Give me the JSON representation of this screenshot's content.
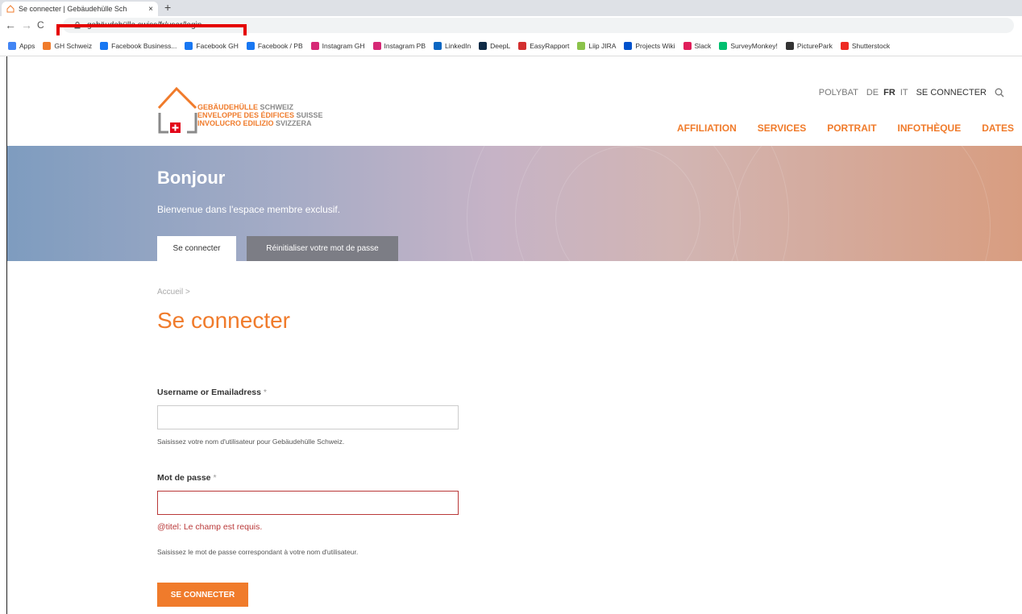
{
  "browser": {
    "tab_title": "Se connecter | Gebäudehülle Sch",
    "tab_close": "×",
    "new_tab": "+",
    "back": "←",
    "forward": "→",
    "reload": "C",
    "url": "gebäudehülle.swiss/fr/user/login",
    "bookmarks": [
      {
        "label": "Apps",
        "icon": "apps-grid-icon",
        "color": "#4285f4"
      },
      {
        "label": "GH Schweiz",
        "icon": "house-icon",
        "color": "#f07b2b"
      },
      {
        "label": "Facebook Business...",
        "icon": "meta-icon",
        "color": "#1877f2"
      },
      {
        "label": "Facebook GH",
        "icon": "facebook-icon",
        "color": "#1877f2"
      },
      {
        "label": "Facebook / PB",
        "icon": "facebook-icon",
        "color": "#1877f2"
      },
      {
        "label": "Instagram GH",
        "icon": "instagram-icon",
        "color": "#d62976"
      },
      {
        "label": "Instagram PB",
        "icon": "instagram-icon",
        "color": "#d62976"
      },
      {
        "label": "LinkedIn",
        "icon": "linkedin-icon",
        "color": "#0a66c2"
      },
      {
        "label": "DeepL",
        "icon": "deepl-icon",
        "color": "#0f2b46"
      },
      {
        "label": "EasyRapport",
        "icon": "easyrapport-icon",
        "color": "#d32f2f"
      },
      {
        "label": "Liip JIRA",
        "icon": "jira-icon",
        "color": "#8bc34a"
      },
      {
        "label": "Projects Wiki",
        "icon": "confluence-icon",
        "color": "#0052cc"
      },
      {
        "label": "Slack",
        "icon": "slack-icon",
        "color": "#e01e5a"
      },
      {
        "label": "SurveyMonkey!",
        "icon": "surveymonkey-icon",
        "color": "#00bf6f"
      },
      {
        "label": "PicturePark",
        "icon": "picturepark-icon",
        "color": "#333333"
      },
      {
        "label": "Shutterstock",
        "icon": "shutterstock-icon",
        "color": "#ee2b24"
      }
    ]
  },
  "site": {
    "logo_lines": [
      {
        "orange": "GEBÄUDEHÜLLE",
        "grey": "SCHWEIZ"
      },
      {
        "orange": "ENVELOPPE DES ÉDIFICES",
        "grey": "SUISSE"
      },
      {
        "orange": "INVOLUCRO EDILIZIO",
        "grey": "SVIZZERA"
      }
    ],
    "util_nav": {
      "polybat": "POLYBAT",
      "langs": [
        "DE",
        "FR",
        "IT"
      ],
      "current_lang": "FR",
      "login": "SE CONNECTER"
    },
    "main_nav": [
      "AFFILIATION",
      "SERVICES",
      "PORTRAIT",
      "INFOTHÈQUE",
      "DATES"
    ],
    "accent": "#f07b2b"
  },
  "hero": {
    "title": "Bonjour",
    "subtitle": "Bienvenue dans l'espace membre exclusif.",
    "tabs": {
      "active": "Se connecter",
      "inactive": "Réinitialiser votre mot de passe"
    }
  },
  "content": {
    "breadcrumb": "Accueil",
    "breadcrumb_sep": ">",
    "page_title": "Se connecter",
    "username": {
      "label": "Username or Emailadress",
      "required": "*",
      "value": "",
      "help": "Saisissez votre nom d'utilisateur pour Gebäudehülle Schweiz."
    },
    "password": {
      "label": "Mot de passe",
      "required": "*",
      "value": "",
      "error": "@titel: Le champ est requis.",
      "help": "Saisissez le mot de passe correspondant à votre nom d'utilisateur."
    },
    "submit": "SE CONNECTER"
  }
}
